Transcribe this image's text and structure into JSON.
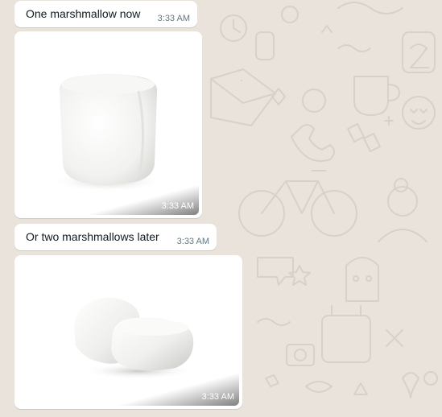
{
  "theme": {
    "chat_background": "#e9e3dc",
    "bubble_background": "#ffffff",
    "time_color": "#667781",
    "text_color": "#111b21"
  },
  "messages": [
    {
      "type": "text",
      "text": "One marshmallow now",
      "time": "3:33 AM"
    },
    {
      "type": "image",
      "image": "single-marshmallow-photo",
      "time": "3:33 AM"
    },
    {
      "type": "text",
      "text": "Or two marshmallows later",
      "time": "3:33 AM"
    },
    {
      "type": "image",
      "image": "two-marshmallows-photo",
      "time": "3:33 AM"
    }
  ]
}
